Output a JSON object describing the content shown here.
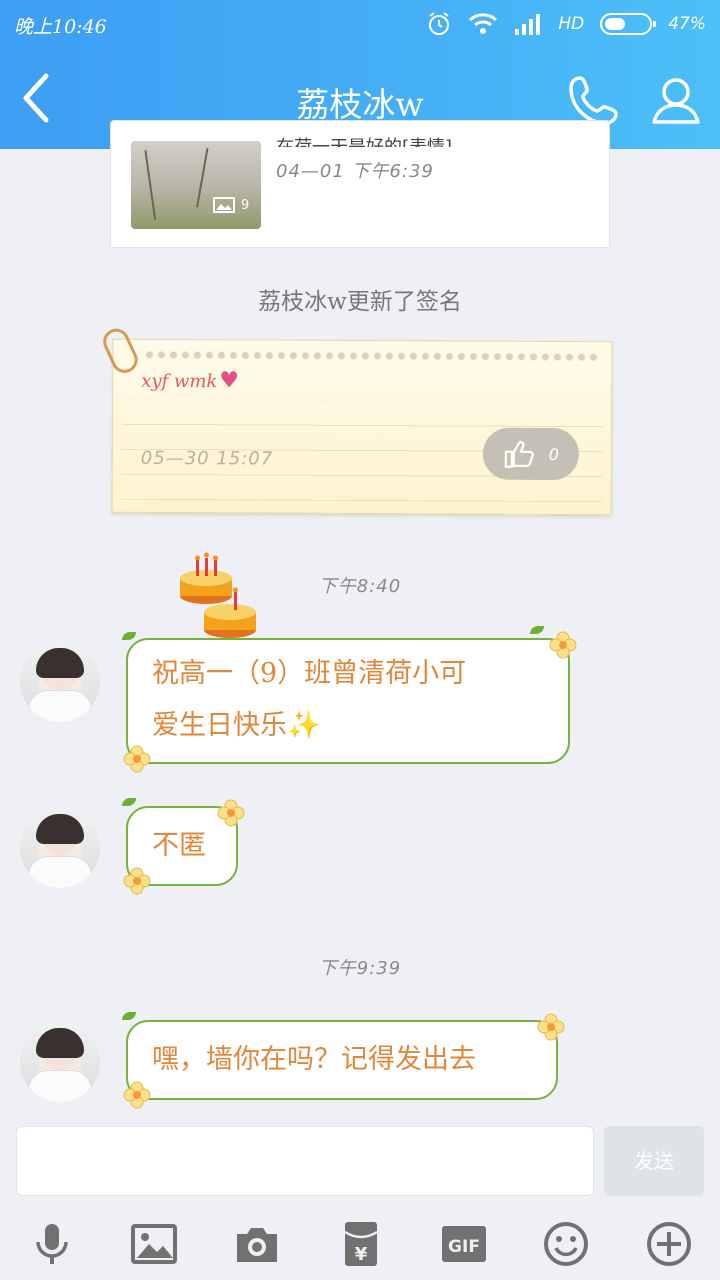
{
  "status_bar": {
    "time": "晚上10:46",
    "network": "HD",
    "battery_percent": "47%",
    "battery_level": 0.47
  },
  "header": {
    "title": "荔枝冰w",
    "back_icon": "chevron-left-icon",
    "call_icon": "phone-icon",
    "profile_icon": "person-icon"
  },
  "feed_card": {
    "title_partial": "在荷一天是好的[表情]",
    "date": "04—01  下午6:39",
    "image_count": "9"
  },
  "system_note": "荔枝冰w更新了签名",
  "signature_note": {
    "text": "xyf  wmk",
    "date": "05—30  15:07",
    "like_count": "0"
  },
  "timestamps": {
    "first": "下午8:40",
    "second": "下午9:39"
  },
  "messages": [
    {
      "line1": "祝高一（9）班曾清荷小可",
      "line2": "爱生日快乐✨"
    },
    {
      "line1": "不匿"
    },
    {
      "line1": "嘿，墙你在吗？记得发出去"
    }
  ],
  "composer": {
    "input_value": "",
    "send_label": "发送"
  },
  "toolbar": {
    "gif_label": "GIF",
    "items": [
      "microphone-icon",
      "image-icon",
      "camera-icon",
      "red-packet-icon",
      "gif-icon",
      "emoji-icon",
      "plus-icon"
    ]
  },
  "colors": {
    "header_gradient_start": "#3d9ef3",
    "header_gradient_end": "#4cc0f8",
    "bubble_border": "#76b33a",
    "bubble_text": "#e1873b",
    "background": "#eef0f5"
  }
}
